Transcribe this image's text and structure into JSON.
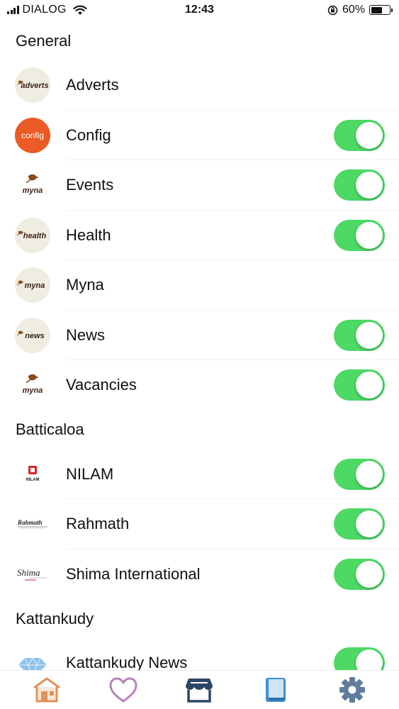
{
  "status_bar": {
    "carrier": "DIALOG",
    "time": "12:43",
    "battery_percent": "60%",
    "battery_level": 0.6
  },
  "sections": [
    {
      "title": "General",
      "items": [
        {
          "label": "Adverts",
          "logo": "adverts-logo",
          "logo_text": "adverts",
          "toggle": false
        },
        {
          "label": "Config",
          "logo": "config-logo",
          "logo_text": "config",
          "toggle": true
        },
        {
          "label": "Events",
          "logo": "myna-bird-logo",
          "logo_text": "myna",
          "toggle": true
        },
        {
          "label": "Health",
          "logo": "health-logo",
          "logo_text": "health",
          "toggle": true
        },
        {
          "label": "Myna",
          "logo": "myna-logo",
          "logo_text": "myna",
          "toggle": false
        },
        {
          "label": "News",
          "logo": "news-logo",
          "logo_text": "news",
          "toggle": true
        },
        {
          "label": "Vacancies",
          "logo": "myna-bird-logo",
          "logo_text": "myna",
          "toggle": true
        }
      ]
    },
    {
      "title": "Batticaloa",
      "items": [
        {
          "label": "NILAM",
          "logo": "nilam-logo",
          "logo_text": "NILAM",
          "toggle": true
        },
        {
          "label": "Rahmath",
          "logo": "rahmath-logo",
          "logo_text": "Rahmath",
          "toggle": true
        },
        {
          "label": "Shima International",
          "logo": "shima-logo",
          "logo_text": "Shima",
          "toggle": true
        }
      ]
    },
    {
      "title": "Kattankudy",
      "items": [
        {
          "label": "Kattankudy News",
          "logo": "diamond-logo",
          "logo_text": "",
          "toggle": true
        }
      ]
    }
  ],
  "tab_bar": {
    "tabs": [
      {
        "name": "home-icon",
        "color": "#e0925a"
      },
      {
        "name": "heart-icon",
        "color": "#b681b8"
      },
      {
        "name": "store-icon",
        "color": "#2e4666"
      },
      {
        "name": "book-icon",
        "color": "#3e8fd4"
      },
      {
        "name": "gear-icon",
        "color": "#607d9b"
      }
    ]
  },
  "colors": {
    "toggle_on": "#4cd964",
    "logo_cream": "#efece1",
    "config_orange": "#ea5b25"
  }
}
